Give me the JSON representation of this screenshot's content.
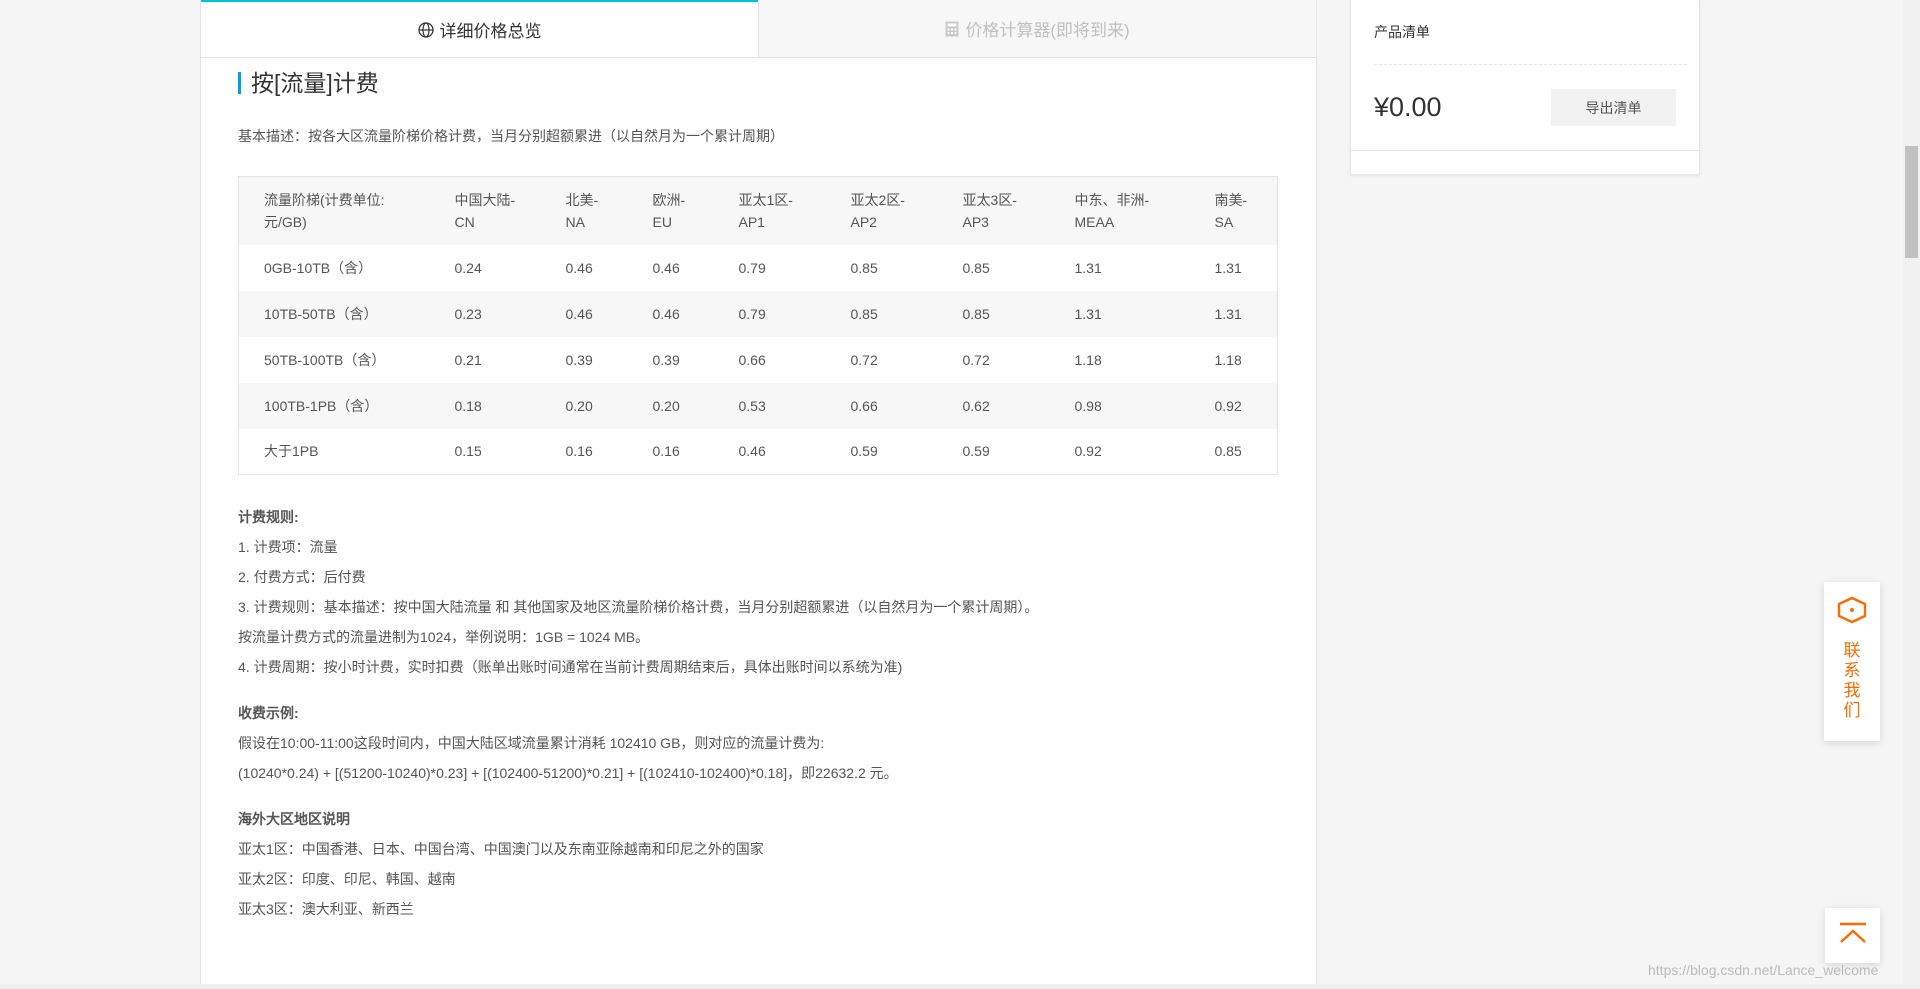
{
  "tabs": [
    {
      "label": "详细价格总览",
      "icon": "globe-icon",
      "active": true
    },
    {
      "label": "价格计算器(即将到来)",
      "icon": "calculator-icon",
      "active": false
    }
  ],
  "section": {
    "title": "按[流量]计费",
    "description": "基本描述：按各大区流量阶梯价格计费，当月分别超额累进（以自然月为一个累计周期）"
  },
  "table": {
    "headers": [
      "流量阶梯(计费单位:元/GB)",
      "中国大陆-CN",
      "北美-NA",
      "欧洲-EU",
      "亚太1区-AP1",
      "亚太2区-AP2",
      "亚太3区-AP3",
      "中东、非洲-MEAA",
      "南美-SA"
    ],
    "rows": [
      [
        "0GB-10TB（含）",
        "0.24",
        "0.46",
        "0.46",
        "0.79",
        "0.85",
        "0.85",
        "1.31",
        "1.31"
      ],
      [
        "10TB-50TB（含）",
        "0.23",
        "0.46",
        "0.46",
        "0.79",
        "0.85",
        "0.85",
        "1.31",
        "1.31"
      ],
      [
        "50TB-100TB（含）",
        "0.21",
        "0.39",
        "0.39",
        "0.66",
        "0.72",
        "0.72",
        "1.18",
        "1.18"
      ],
      [
        "100TB-1PB（含）",
        "0.18",
        "0.20",
        "0.20",
        "0.53",
        "0.66",
        "0.62",
        "0.98",
        "0.92"
      ],
      [
        "大于1PB",
        "0.15",
        "0.16",
        "0.16",
        "0.46",
        "0.59",
        "0.59",
        "0.92",
        "0.85"
      ]
    ]
  },
  "rules": {
    "heading": "计费规则:",
    "lines": [
      "1. 计费项：流量",
      "2. 付费方式：后付费",
      "3. 计费规则：基本描述：按中国大陆流量 和 其他国家及地区流量阶梯价格计费，当月分别超额累进（以自然月为一个累计周期）。",
      "按流量计费方式的流量进制为1024，举例说明：1GB = 1024 MB。",
      "4. 计费周期：按小时计费，实时扣费（账单出账时间通常在当前计费周期结束后，具体出账时间以系统为准)"
    ]
  },
  "example": {
    "heading": "收费示例:",
    "lines": [
      "假设在10:00-11:00这段时间内，中国大陆区域流量累计消耗 102410 GB，则对应的流量计费为:",
      "(10240*0.24) + [(51200-10240)*0.23] + [(102400-51200)*0.21] + [(102410-102400)*0.18]，即22632.2 元。"
    ]
  },
  "regions": {
    "heading": "海外大区地区说明",
    "lines": [
      "亚太1区：中国香港、日本、中国台湾、中国澳门以及东南亚除越南和印尼之外的国家",
      "亚太2区：印度、印尼、韩国、越南",
      "亚太3区：澳大利亚、新西兰"
    ]
  },
  "sidebar": {
    "title": "产品清单",
    "total": "¥0.00",
    "export_label": "导出清单"
  },
  "contact": {
    "label": "联系我们"
  },
  "watermark": "https://blog.csdn.net/Lance_welcome",
  "colors": {
    "accent": "#00c1de",
    "title_bar": "#00a0e9",
    "contact": "#ff6a00"
  }
}
